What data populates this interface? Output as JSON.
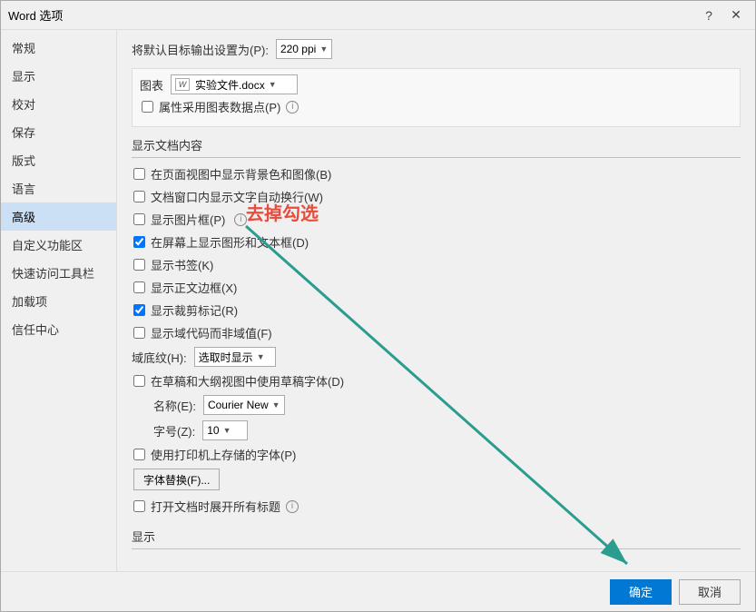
{
  "dialog": {
    "title": "Word 选项",
    "help_btn": "?",
    "close_btn": "✕"
  },
  "sidebar": {
    "items": [
      {
        "label": "常规",
        "active": false
      },
      {
        "label": "显示",
        "active": false
      },
      {
        "label": "校对",
        "active": false
      },
      {
        "label": "保存",
        "active": false
      },
      {
        "label": "版式",
        "active": false
      },
      {
        "label": "语言",
        "active": false
      },
      {
        "label": "高级",
        "active": true
      },
      {
        "label": "自定义功能区",
        "active": false
      },
      {
        "label": "快速访问工具栏",
        "active": false
      },
      {
        "label": "加载项",
        "active": false
      },
      {
        "label": "信任中心",
        "active": false
      }
    ]
  },
  "content": {
    "ppi_label": "将默认目标输出设置为(P):",
    "ppi_value": "220 ppi",
    "chart_label": "图表",
    "chart_file": "实验文件.docx",
    "chart_checkbox_label": "属性采用图表数据点(P)",
    "display_section": "显示文档内容",
    "checkboxes": [
      {
        "id": "cb1",
        "label": "在页面视图中显示背景色和图像(B)",
        "checked": false
      },
      {
        "id": "cb2",
        "label": "文档窗口内显示文字自动换行(W)",
        "checked": false
      },
      {
        "id": "cb3",
        "label": "显示图片框(P)",
        "checked": false
      },
      {
        "id": "cb4",
        "label": "在屏幕上显示图形和文本框(D)",
        "checked": true
      },
      {
        "id": "cb5",
        "label": "显示书签(K)",
        "checked": false
      },
      {
        "id": "cb6",
        "label": "显示正文边框(X)",
        "checked": false
      },
      {
        "id": "cb7",
        "label": "显示裁剪标记(R)",
        "checked": true
      },
      {
        "id": "cb8",
        "label": "显示域代码而非域值(F)",
        "checked": false
      }
    ],
    "field_shading_label": "域底纹(H):",
    "field_shading_value": "选取时显示",
    "cb_draft": {
      "label": "在草稿和大纲视图中使用草稿字体(D)",
      "checked": false
    },
    "font_name_label": "名称(E):",
    "font_name_value": "Courier New",
    "font_size_label": "字号(Z):",
    "font_size_value": "10",
    "cb_printer": {
      "label": "使用打印机上存储的字体(P)",
      "checked": false
    },
    "font_sub_btn": "字体替换(F)...",
    "cb_expand": {
      "label": "打开文档时展开所有标题",
      "checked": false
    },
    "display_section2": "显示",
    "annotation_text": "去掉勾选"
  },
  "footer": {
    "ok_label": "确定",
    "cancel_label": "取消"
  }
}
